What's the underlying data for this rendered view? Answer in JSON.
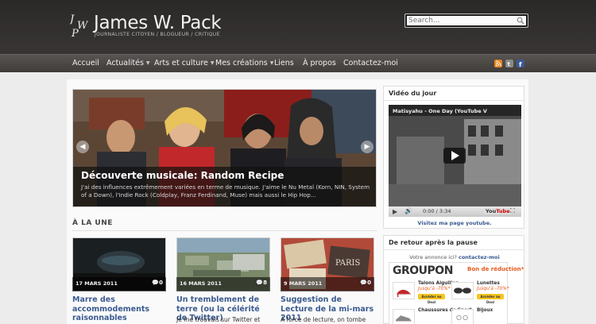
{
  "header": {
    "logo_initials": "JWP",
    "site_title": "James W. Pack",
    "tagline": "JOURNALISTE CITOYEN / BLOGUEUR / CRITIQUE",
    "search_placeholder": "Search..."
  },
  "nav": {
    "items": [
      {
        "label": "Accueil",
        "has_submenu": false
      },
      {
        "label": "Actualités",
        "has_submenu": true
      },
      {
        "label": "Arts et culture",
        "has_submenu": true
      },
      {
        "label": "Mes créations",
        "has_submenu": true
      },
      {
        "label": "Liens",
        "has_submenu": false
      },
      {
        "label": "À propos",
        "has_submenu": false
      },
      {
        "label": "Contactez-moi",
        "has_submenu": false
      }
    ],
    "social_icons": [
      "rss-icon",
      "twitter-icon",
      "facebook-icon"
    ]
  },
  "slider": {
    "title": "Découverte musicale: Random Recipe",
    "excerpt": "J'ai des influences extrêmement variées en terme de musique. J'aime le Nu Metal (Korn, NIN, System of a Down), l'Indie Rock (Coldplay, Franz Ferdinand, Muse) mais aussi le Hip Hop..."
  },
  "featured": {
    "heading": "À LA UNE",
    "cards": [
      {
        "date": "17 MARS 2011",
        "comments": "0",
        "title": "Marre des accommodements raisonnables",
        "excerpt": ""
      },
      {
        "date": "16 MARS 2011",
        "comments": "8",
        "title": "Un tremblement de terre (ou la célérité de Twitter)",
        "excerpt": "Je me trouvais sur Twitter et"
      },
      {
        "date": "9 MARS 2011",
        "comments": "0",
        "title": "Suggestion de Lecture de la mi-mars 2011",
        "excerpt": "À force de lecture, on tombe"
      }
    ]
  },
  "sidebar": {
    "video": {
      "heading": "Vidéo du jour",
      "video_title": "Matisyahu - One Day (YouTube V",
      "time": "0:00 / 3:34",
      "link": "Visitez ma page youtube."
    },
    "ad": {
      "heading": "De retour après la pause",
      "line_prefix": "Votre annonce ici?",
      "line_link": "contactez-moi",
      "brand": "GROUPON",
      "tag": "Bon de réduction*",
      "deals": [
        {
          "name": "Talons Aiguilles",
          "discount": "Jusqu'à -70%*",
          "button": "Accéder au Deal"
        },
        {
          "name": "Lunettes",
          "discount": "Jusqu'à -70%*",
          "button": "Accéder au Deal"
        },
        {
          "name": "Chaussures de Sport",
          "discount": "",
          "button": ""
        },
        {
          "name": "Bijoux",
          "discount": "",
          "button": ""
        }
      ]
    }
  },
  "colors": {
    "header_bg": "#2b2928",
    "nav_bg": "#4a4745",
    "link": "#3a5a8f",
    "groupon_orange": "#e65a1e"
  }
}
